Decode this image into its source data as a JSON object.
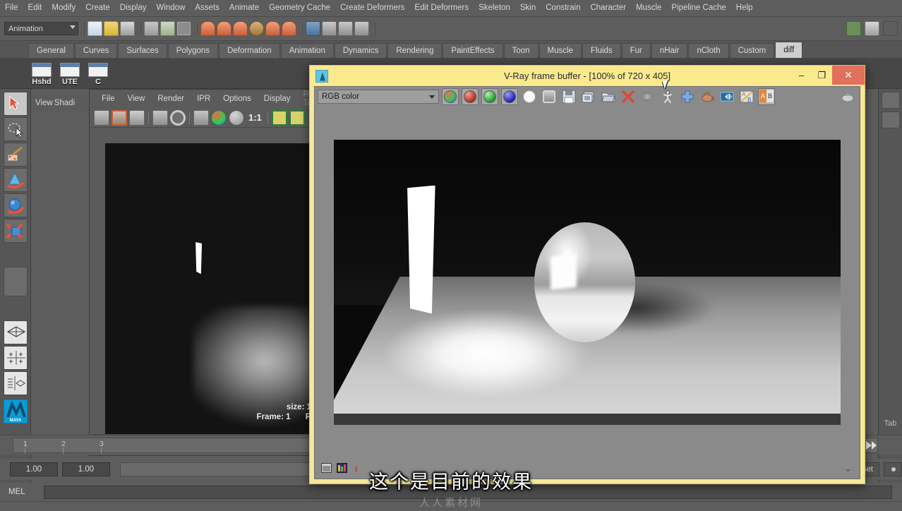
{
  "app": {
    "menus": [
      "File",
      "Edit",
      "Modify",
      "Create",
      "Display",
      "Window",
      "Assets",
      "Animate",
      "Geometry Cache",
      "Create Deformers",
      "Edit Deformers",
      "Skeleton",
      "Skin",
      "Constrain",
      "Character",
      "Muscle",
      "Pipeline Cache",
      "Help"
    ],
    "mode_selector": "Animation"
  },
  "shelf": {
    "tabs": [
      "General",
      "Curves",
      "Surfaces",
      "Polygons",
      "Deformation",
      "Animation",
      "Dynamics",
      "Rendering",
      "PaintEffects",
      "Toon",
      "Muscle",
      "Fluids",
      "Fur",
      "nHair",
      "nCloth",
      "Custom",
      "diff"
    ],
    "active_tab": "diff",
    "buttons": [
      {
        "label": "Hshd"
      },
      {
        "label": "UTE"
      },
      {
        "label": "C"
      }
    ]
  },
  "render_view": {
    "menus": [
      "File",
      "View",
      "Render",
      "IPR",
      "Options",
      "Display",
      "Render Ta"
    ],
    "dim_menu": "Render Ta",
    "zoom_label": "1:1",
    "status_size": "size: 1",
    "status_frame": "Frame: 1",
    "status_extra": "R"
  },
  "panel": {
    "menus": [
      "View",
      "Shadi"
    ]
  },
  "vray": {
    "title": "V-Ray frame buffer - [100% of 720 x 405]",
    "window_buttons": {
      "minimize": "–",
      "maximize": "❐",
      "close": "✕"
    },
    "channel_select": "RGB color",
    "channel_buttons": [
      "rgb-channel",
      "red-channel",
      "green-channel",
      "blue-channel",
      "alpha-channel",
      "monochrome-channel"
    ],
    "toolbar_icons": [
      "save-image-icon",
      "save-all-image-icons",
      "load-image-icon",
      "clear-image-icon",
      "render-last-icon",
      "track-mouse-icon",
      "region-render-icon",
      "teapot-preview-icon",
      "switch-buffer-icon",
      "ab-compare-icon",
      "ab-split-icon",
      "color-corrections-icon"
    ],
    "bottom_icons": [
      "pixel-info-icon",
      "histogram-icon",
      "info-icon"
    ],
    "colors": {
      "title_bar": "#fbe98e",
      "frame": "#f6e79a",
      "close_button": "#e1705d",
      "body": "#8a8a8a",
      "red_channel": "#b03020",
      "green_channel": "#12a02a",
      "blue_channel": "#2020b8"
    }
  },
  "timeline": {
    "ticks": [
      "1",
      "2",
      "3"
    ],
    "start_field": "1.00",
    "end_field": "1.00",
    "char_set_label": "er Set",
    "tab_label": "Tab"
  },
  "command_line": {
    "language": "MEL",
    "value": ""
  },
  "subtitle": {
    "text": "这个是目前的效果",
    "watermark": "人人素材网"
  }
}
